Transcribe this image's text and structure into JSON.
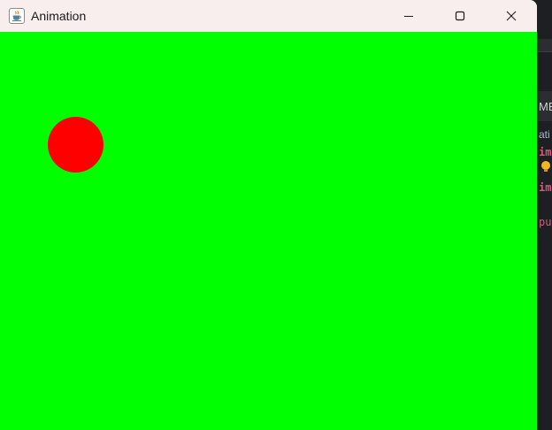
{
  "window": {
    "title": "Animation",
    "app_icon": "java-cup-icon",
    "controls": {
      "minimize_icon": "minimize-icon",
      "maximize_icon": "maximize-icon",
      "close_icon": "close-icon"
    }
  },
  "canvas": {
    "background_color": "#00ff00",
    "ball_color": "#ff0000"
  },
  "background_ide": {
    "tab_fragment": "ME",
    "path_fragment": "ati",
    "code_line_1": "im",
    "code_line_2": "im",
    "code_line_3": "pu"
  }
}
